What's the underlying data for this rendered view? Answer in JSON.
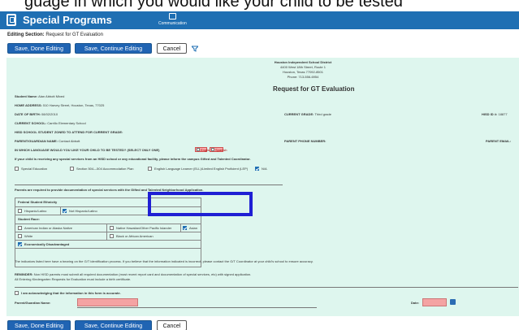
{
  "caption_fragment": "guage in which you would like your child to be tested",
  "header": {
    "app_title": "Special Programs",
    "communication_label": "Communication",
    "brand_color": "#1f6fb3"
  },
  "editing_section": {
    "label": "Editing Section:",
    "value": "Request for GT Evaluation"
  },
  "toolbar_top": {
    "save_done": "Save, Done Editing",
    "save_continue": "Save, Continue Editing",
    "cancel": "Cancel",
    "filter_icon": "funnel-icon"
  },
  "letterhead": {
    "district": "Houston Independent School District",
    "street": "4400 West 18th Street, Route 1",
    "city": "Houston, Texas 77092-8501",
    "phone": "Phone: 713-556-6954"
  },
  "form": {
    "title": "Request for GT Evaluation",
    "student_name_label": "Student Name:",
    "student_name": "Alan Abbott Mixed",
    "home_address_label": "HOME ADDRESS:",
    "home_address": "510 Harvey Street, Houston, Texas, 77025",
    "dob_label": "DATE OF BIRTH:",
    "dob": "08/02/2010",
    "current_grade_label": "CURRENT GRADE:",
    "current_grade": "Third grade",
    "hisd_id_label": "HISD ID #:",
    "hisd_id": "18877",
    "current_school_label": "CURRENT SCHOOL:",
    "current_school": "Carrillo Elementary School",
    "zoned_school_label": "HISD SCHOOL STUDENT ZONED TO ATTEND FOR CURRENT GRADE:",
    "parent_label": "PARENT/GUARDIAN NAME:",
    "parent_name": "Contact Abbott",
    "parent_phone_label": "PARENT PHONE NUMBER:",
    "parent_email_label": "PARENT EMAIL:",
    "language_question": "IN WHICH LANGUAGE WOULD YOU LIKE YOUR CHILD TO BE TESTED? (SELECT ONLY ONE)",
    "language_options": [
      "English",
      "Spanish"
    ],
    "special_services_note": "If your child is receiving any special services from an HISD school or any educational facility, please inform the campus Gifted and Talented Coordinator.",
    "services": [
      {
        "label": "Special Education",
        "checked": false
      },
      {
        "label": "Section 504—504 Accommodation Plan",
        "checked": false
      },
      {
        "label": "English Language Learner (ELL)/Limited English Proficient (LEP)",
        "checked": false
      },
      {
        "label": "N/A",
        "checked": true
      }
    ],
    "documentation_note": "Parents are required to provide documentation of special services with the Gifted and Talented Neighborhood Application.",
    "ethnicity_header": "Federal Student Ethnicity",
    "ethnicity": [
      {
        "label": "Hispanic/Latino",
        "checked": false
      },
      {
        "label": "Not Hispanic/Latino",
        "checked": true
      }
    ],
    "race_header": "Student Race:",
    "race": [
      {
        "label": "American Indian or Alaska Native",
        "checked": false
      },
      {
        "label": "Native Hawaiian/Other Pacific Islander",
        "checked": false
      },
      {
        "label": "Asian",
        "checked": true
      },
      {
        "label": "White",
        "checked": false
      },
      {
        "label": "Black or African American",
        "checked": false
      }
    ],
    "econ_label": "Economically Disadvantaged",
    "econ_checked": true,
    "indicators_text": "The indicators listed here have a bearing on the G/T identification process. If you believe that the information indicated is incorrect, please contact the G/T Coordinator at your child's school to ensure accuracy.",
    "reminder_label": "REMINDER:",
    "reminder_text": "Non HISD parents must submit all required documentation (most recent report card and documentation of special services, etc) with signed application.",
    "reminder_text2": "All Entering Kindergarten Requests for Evaluation must include a birth certificate.",
    "ack_label": "I am acknowledging that the information in this form is accurate.",
    "parent_guardian_name_label": "Parent/Guardian Name:",
    "date_label": "Date:"
  },
  "toolbar_bottom": {
    "save_done": "Save, Done Editing",
    "save_continue": "Save, Continue Editing",
    "cancel": "Cancel"
  }
}
